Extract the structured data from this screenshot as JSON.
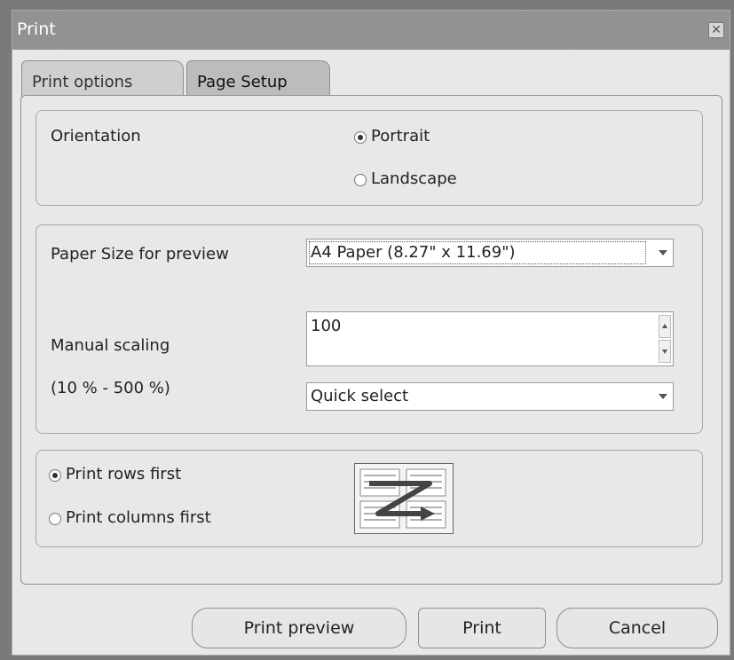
{
  "window": {
    "title": "Print"
  },
  "tabs": [
    {
      "label": "Print options",
      "active": false
    },
    {
      "label": "Page Setup",
      "active": true
    }
  ],
  "orientation": {
    "label": "Orientation",
    "options": [
      {
        "label": "Portrait",
        "selected": true
      },
      {
        "label": "Landscape",
        "selected": false
      }
    ]
  },
  "paper": {
    "size_label": "Paper Size for preview",
    "size_value": "A4 Paper  (8.27\" x 11.69\")",
    "scaling_label": "Manual scaling",
    "scaling_range": "(10 % - 500 %)",
    "scaling_value": "100",
    "quick_select": "Quick select"
  },
  "print_order": {
    "options": [
      {
        "label": "Print rows first",
        "selected": true
      },
      {
        "label": "Print columns first",
        "selected": false
      }
    ],
    "icon": "page-order-z-icon"
  },
  "buttons": {
    "preview": "Print preview",
    "print": "Print",
    "cancel": "Cancel"
  },
  "colors": {
    "dialog_bg": "#e8e8e8",
    "titlebar": "#8f8f8f",
    "active_tab": "#bcbcbc",
    "inactive_tab": "#cfcfcf"
  }
}
